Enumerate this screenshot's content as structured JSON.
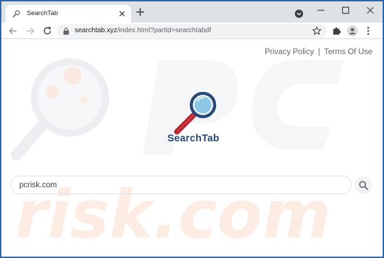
{
  "browser": {
    "tab_title": "SearchTab",
    "url_host": "searchtab.xyz",
    "url_rest": "/index.html?partid=searchtabdf"
  },
  "header_links": {
    "privacy": "Privacy Policy",
    "separator": "|",
    "terms": "Terms Of Use"
  },
  "logo": {
    "text": "SearchTab",
    "icon": "magnifier-icon",
    "text_color": "#274a78",
    "handle_color": "#b3242c",
    "lens_color": "#8ec7e6"
  },
  "search": {
    "value": "pcrisk.com",
    "placeholder": ""
  },
  "watermark": {
    "text": "risk.com"
  },
  "colors": {
    "frame": "#2f63a8",
    "tabstrip": "#dee1e6",
    "omnibox": "#f1f3f4"
  }
}
